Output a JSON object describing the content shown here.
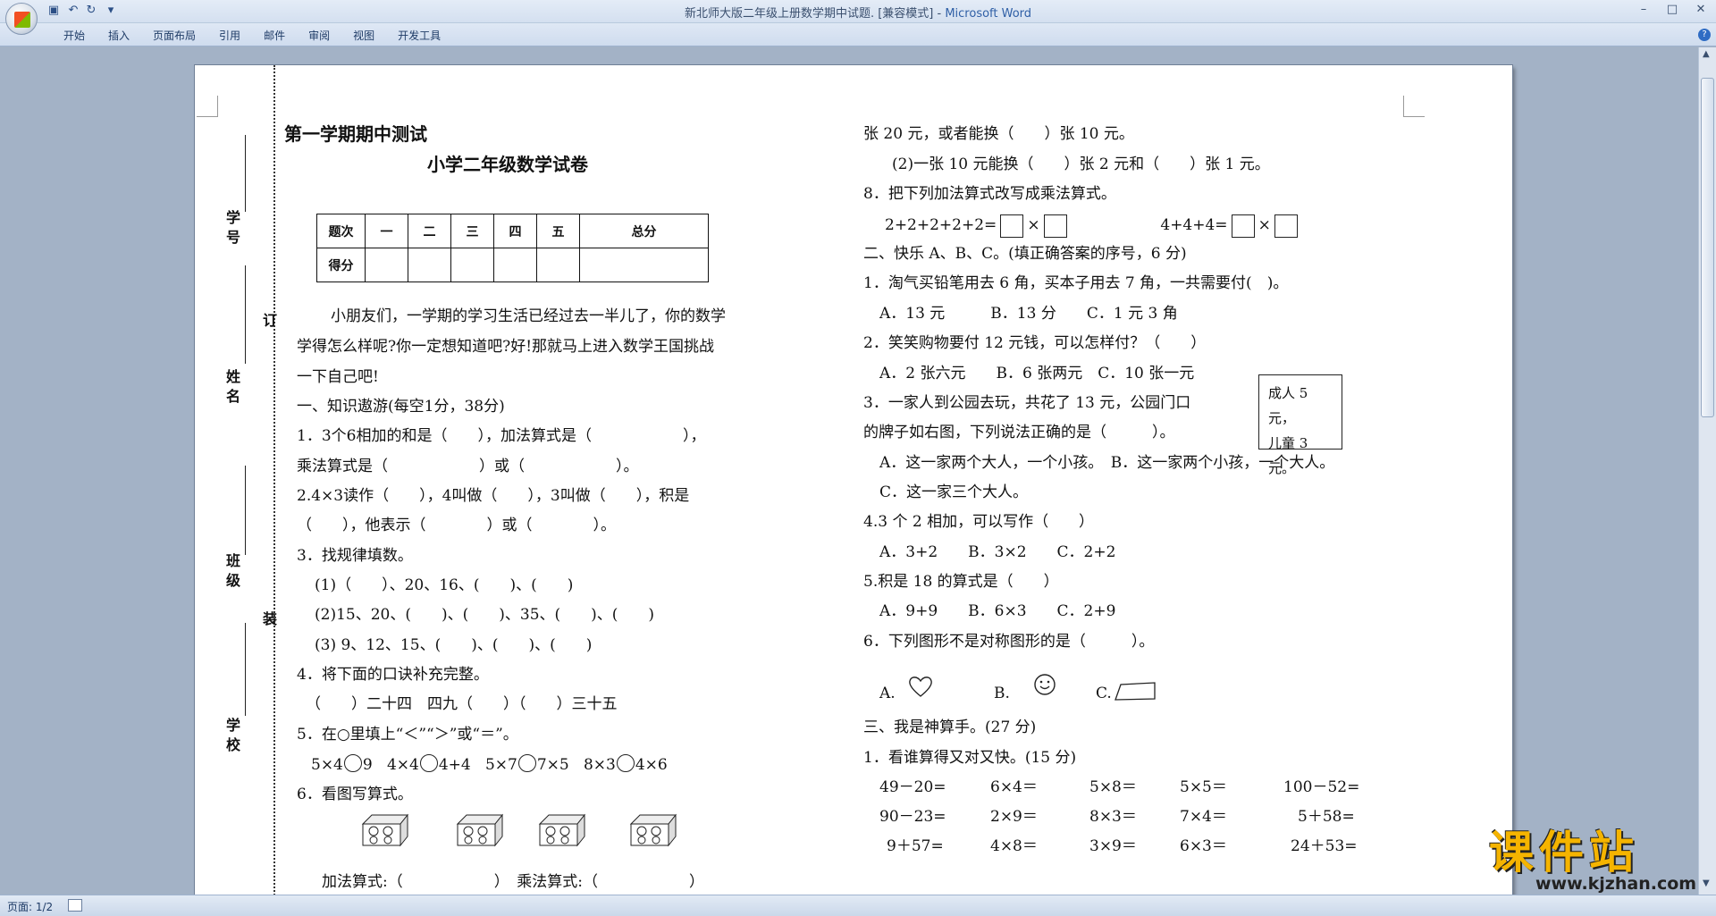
{
  "window": {
    "title": "新北师大版二年级上册数学期中试题. [兼容模式]",
    "app": "Microsoft Word",
    "controls": [
      "–",
      "□",
      "✕"
    ]
  },
  "ribbon": {
    "tabs": [
      "开始",
      "插入",
      "页面布局",
      "引用",
      "邮件",
      "审阅",
      "视图",
      "开发工具"
    ],
    "help": "?"
  },
  "binding": {
    "labels": [
      "学号",
      "姓名",
      "班级",
      "学校"
    ],
    "marks": [
      "订",
      "装"
    ]
  },
  "doc": {
    "title": "第一学期期中测试",
    "subtitle": "小学二年级数学试卷",
    "score_table": {
      "headers": [
        "题次",
        "一",
        "二",
        "三",
        "四",
        "五",
        "总分"
      ],
      "row_label": "得分"
    },
    "intro": [
      "小朋友们，一学期的学习生活已经过去一半儿了，你的数学",
      "学得怎么样呢?你一定想知道吧?好!那就马上进入数学王国挑战",
      "一下自己吧!"
    ],
    "left_lines": [
      "一、知识遨游(每空1分，38分)",
      "1．3个6相加的和是（　　），加法算式是（　　　　　　），",
      "乘法算式是（　　　　　　）或（　　　　　　）。",
      "2.4×3读作（　　），4叫做（　　），3叫做（　　），积是",
      "（　　），他表示（　　　　）或（　　　　）。",
      "3．找规律填数。",
      "(1)（　　）、20、16、(　　)、(　　)",
      "(2)15、20、(　　)、(　　)、35、(　　)、(　　)",
      "(3) 9、12、15、(　　)、(　　)、(　　)",
      "4．将下面的口诀补充完整。",
      "（　　）二十四　四九（　　）（　　）三十五",
      "5．在○里填上“＜”“＞”或“＝”。",
      "6．看图写算式。",
      "加法算式:（　　　　　　）　乘法算式:（　　　　　　）"
    ],
    "compare": [
      "5×4",
      "9",
      "4×4",
      "4+4",
      "5×7",
      "7×5",
      "8×3",
      "4×6"
    ],
    "right_lines": [
      "张 20 元，或者能换（　　）张 10 元。",
      "(2)一张 10 元能换（　　）张 2 元和（　　）张 1 元。",
      "8．把下列加法算式改写成乘法算式。",
      "二、快乐 A、B、C。(填正确答案的序号，6 分)",
      "1．淘气买铅笔用去 6 角，买本子用去 7 角，一共需要付(　)。",
      "A．13 元　　　B．13 分　　C．1 元 3 角",
      "2．笑笑购物要付 12 元钱，可以怎样付？（　　）",
      "A．2 张六元　　B．6 张两元　C．10 张一元",
      "3．一家人到公园去玩，共花了 13 元，公园门口",
      "的牌子如右图，下列说法正确的是（　　　）。",
      "A．这一家两个大人，一个小孩。　B．这一家两个小孩，一个大人。",
      "C．这一家三个大人。",
      "4.3 个 2 相加，可以写作（　　）",
      "A．3+2　　B．3×2　　C．2+2",
      "5.积是 18 的算式是（　　）",
      "A．9+9　　B．6×3　　C．2+9",
      "6．下列图形不是对称图形的是（　　　）。",
      "三、我是神算手。(27 分)",
      "1．看谁算得又对又快。(15 分)"
    ],
    "rewrite": [
      "2+2+2+2+2=",
      "4+4+4="
    ],
    "price_sign": [
      "成人 5 元，",
      "儿童 3 元。"
    ],
    "shape_options": [
      "A.",
      "B.",
      "C."
    ],
    "calc": [
      [
        "49－20=",
        "6×4＝",
        "5×8＝",
        "5×5＝",
        "100－52="
      ],
      [
        "90－23=",
        "2×9＝",
        "8×3＝",
        "7×4＝",
        "5＋58="
      ],
      [
        "9＋57=",
        "4×8＝",
        "3×9＝",
        "6×3＝",
        "24＋53="
      ]
    ]
  },
  "status": {
    "page": "页面: 1/2"
  },
  "watermark": {
    "text": "课件站",
    "url": "www.kjzhan.com"
  }
}
